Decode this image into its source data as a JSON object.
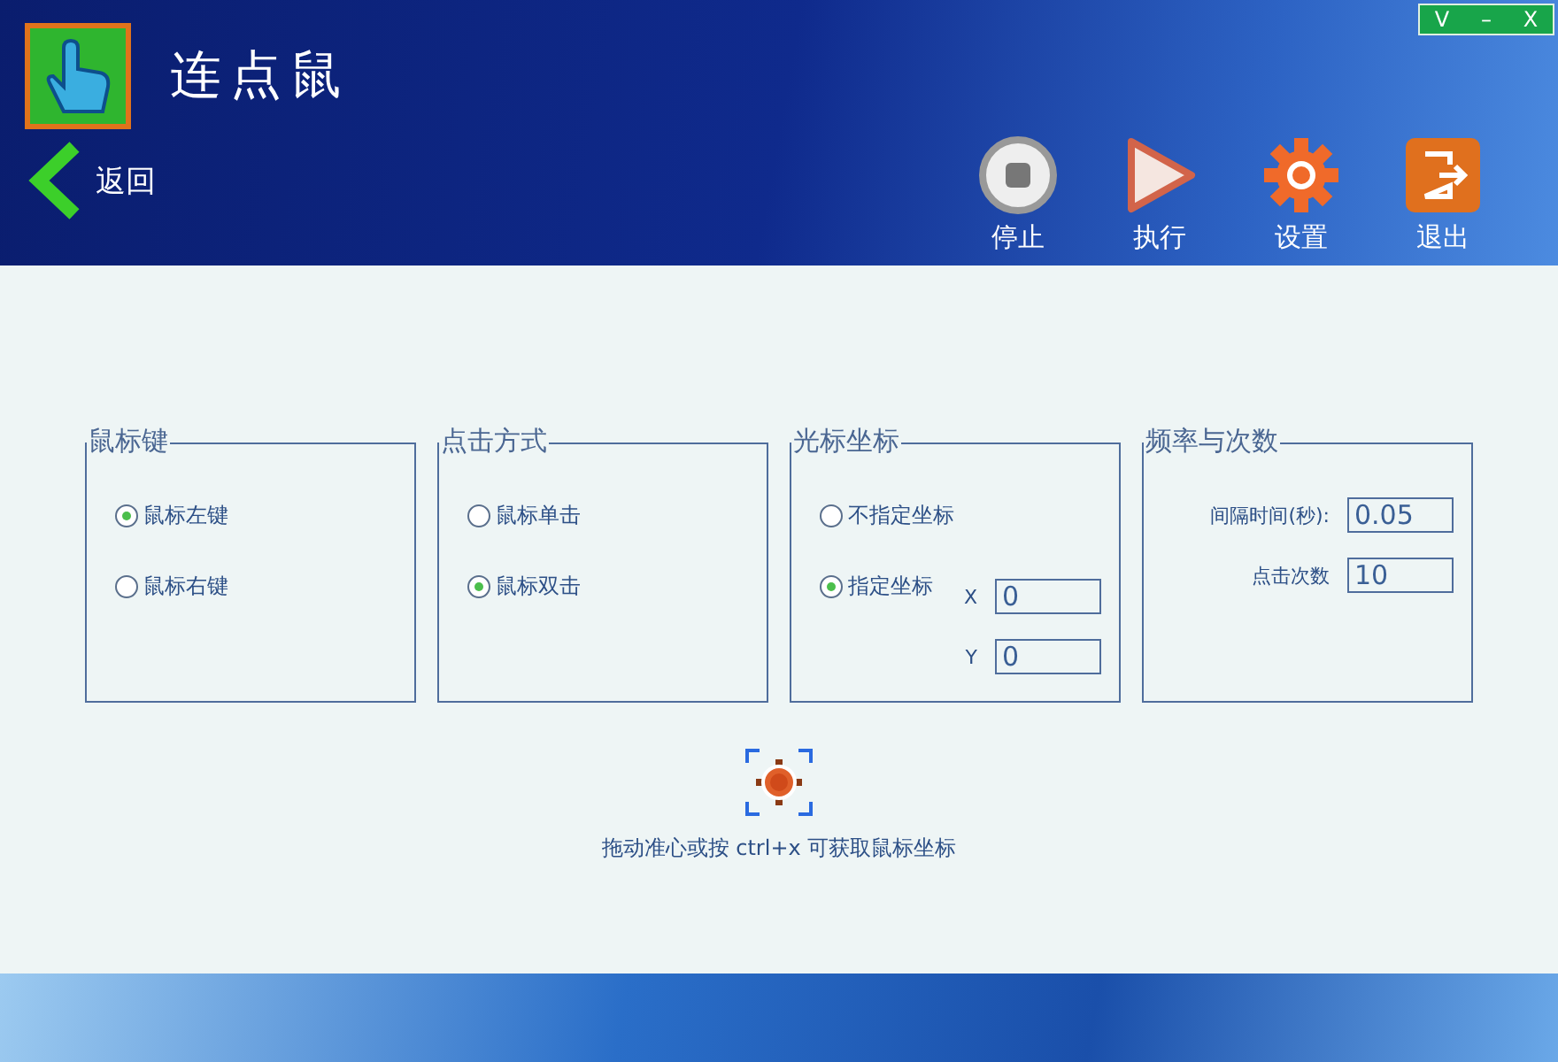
{
  "window": {
    "title": "连点鼠",
    "controls": [
      "V",
      "–",
      "X"
    ]
  },
  "back": {
    "label": "返回"
  },
  "toolbar": [
    {
      "kind": "stop",
      "label": "停止"
    },
    {
      "kind": "run",
      "label": "执行"
    },
    {
      "kind": "settings",
      "label": "设置"
    },
    {
      "kind": "exit",
      "label": "退出"
    }
  ],
  "groups": [
    {
      "title": "鼠标键",
      "options": [
        {
          "label": "鼠标左键",
          "selected": true
        },
        {
          "label": "鼠标右键",
          "selected": false
        }
      ]
    },
    {
      "title": "点击方式",
      "options": [
        {
          "label": "鼠标单击",
          "selected": false
        },
        {
          "label": "鼠标双击",
          "selected": true
        }
      ]
    },
    {
      "title": "光标坐标",
      "options": [
        {
          "label": "不指定坐标",
          "selected": false
        },
        {
          "label": "指定坐标",
          "selected": true
        }
      ],
      "fields": [
        {
          "label": "X",
          "value": "0"
        },
        {
          "label": "Y",
          "value": "0"
        }
      ]
    },
    {
      "title": "频率与次数",
      "fields": [
        {
          "label": "间隔时间(秒):",
          "value": "0.05"
        },
        {
          "label": "点击次数",
          "value": "10"
        }
      ]
    }
  ],
  "crosshair": {
    "hint": "拖动准心或按 ctrl+x 可获取鼠标坐标"
  }
}
